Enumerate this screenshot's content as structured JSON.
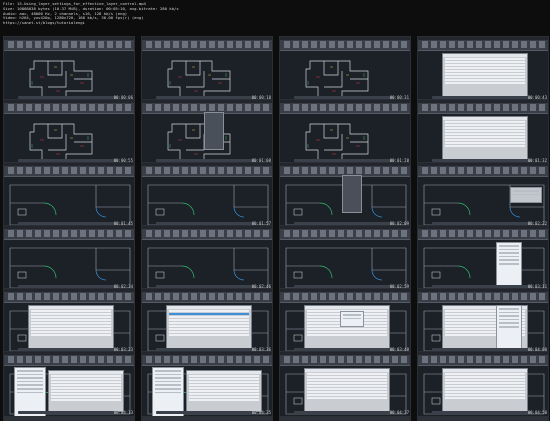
{
  "header": {
    "file": "File: 15-Using_layer_settings_for_effective_layer_control.mp4",
    "size": "Size: 10868038 bytes (10.37 MiB), duration: 00:05:10, avg.bitrate: 280 kb/s",
    "audio": "Audio: aac, 48000 Hz, 2 channels, s16, 128 kb/s (eng)",
    "video": "Video: h264, yuv420p, 1280x720, 168 kb/s, 30.00 fps(r) (eng)",
    "url": "https://sanet.st/blogs/tutorialengi"
  },
  "thumbnails": [
    {
      "time": "00:00:06",
      "kind": "plan"
    },
    {
      "time": "00:00:18",
      "kind": "plan"
    },
    {
      "time": "00:00:31",
      "kind": "plan"
    },
    {
      "time": "00:00:43",
      "kind": "plan-dialog"
    },
    {
      "time": "00:00:55",
      "kind": "plan"
    },
    {
      "time": "00:01:08",
      "kind": "plan-flyout"
    },
    {
      "time": "00:01:20",
      "kind": "plan"
    },
    {
      "time": "00:01:32",
      "kind": "plan-dialog"
    },
    {
      "time": "00:01:45",
      "kind": "room"
    },
    {
      "time": "00:01:57",
      "kind": "room"
    },
    {
      "time": "00:02:09",
      "kind": "room-flyout"
    },
    {
      "time": "00:02:22",
      "kind": "room-tooltip"
    },
    {
      "time": "00:02:34",
      "kind": "room"
    },
    {
      "time": "00:02:46",
      "kind": "room"
    },
    {
      "time": "00:02:59",
      "kind": "room"
    },
    {
      "time": "00:03:11",
      "kind": "room-panel"
    },
    {
      "time": "00:03:23",
      "kind": "dialog"
    },
    {
      "time": "00:03:36",
      "kind": "dialog-blue"
    },
    {
      "time": "00:03:48",
      "kind": "dialog-tip"
    },
    {
      "time": "00:04:00",
      "kind": "dialog-panel"
    },
    {
      "time": "00:04:13",
      "kind": "panel-dialog"
    },
    {
      "time": "00:04:25",
      "kind": "panel-dialog"
    },
    {
      "time": "00:04:37",
      "kind": "dialog"
    },
    {
      "time": "00:04:50",
      "kind": "dialog"
    }
  ]
}
